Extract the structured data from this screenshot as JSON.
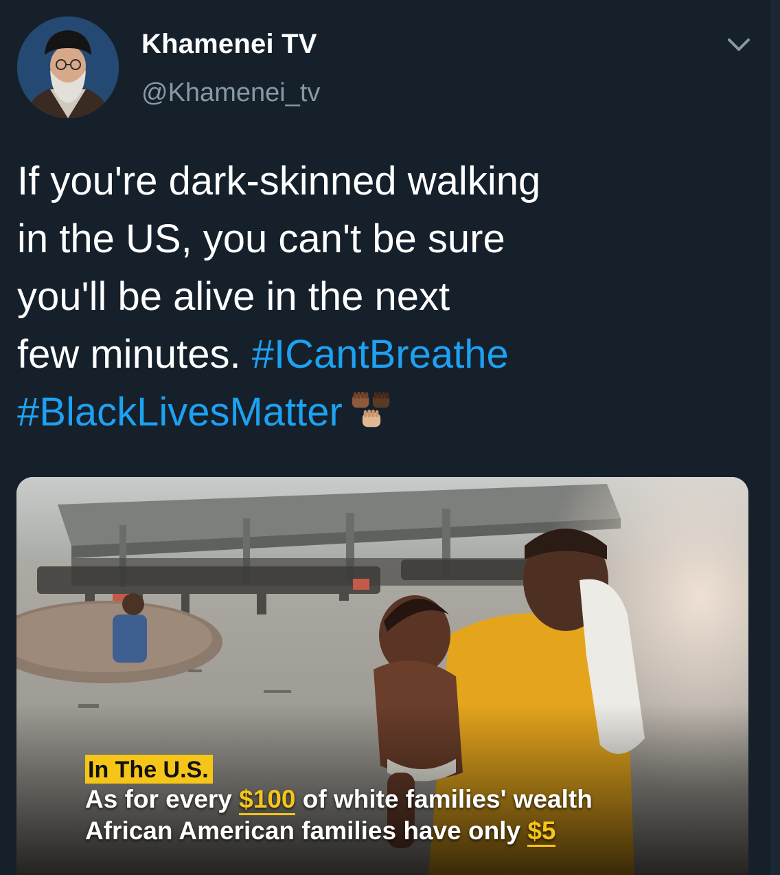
{
  "user": {
    "display_name": "Khamenei TV",
    "handle": "@Khamenei_tv",
    "avatar_icon": "profile-photo"
  },
  "tweet": {
    "text_lines": [
      "If you're dark-skinned walking",
      "in the US, you can't be sure",
      "you'll be alive in the next",
      "few minutes."
    ],
    "hashtags": [
      "#ICantBreathe",
      "#BlackLivesMatter"
    ],
    "emoji": "raised-fists-emoji"
  },
  "media": {
    "caption_title": "In The U.S.",
    "caption_line1_pre": "As for every ",
    "caption_line1_amount": "$100",
    "caption_line1_post": " of white families' wealth",
    "caption_line2_pre": "African American families have only ",
    "caption_line2_amount": "$5"
  },
  "colors": {
    "background": "#15202b",
    "text": "#ffffff",
    "secondary_text": "#8899a6",
    "link": "#1da1f2",
    "caption_highlight": "#f5c518"
  },
  "icons": {
    "menu": "chevron-down-icon"
  }
}
